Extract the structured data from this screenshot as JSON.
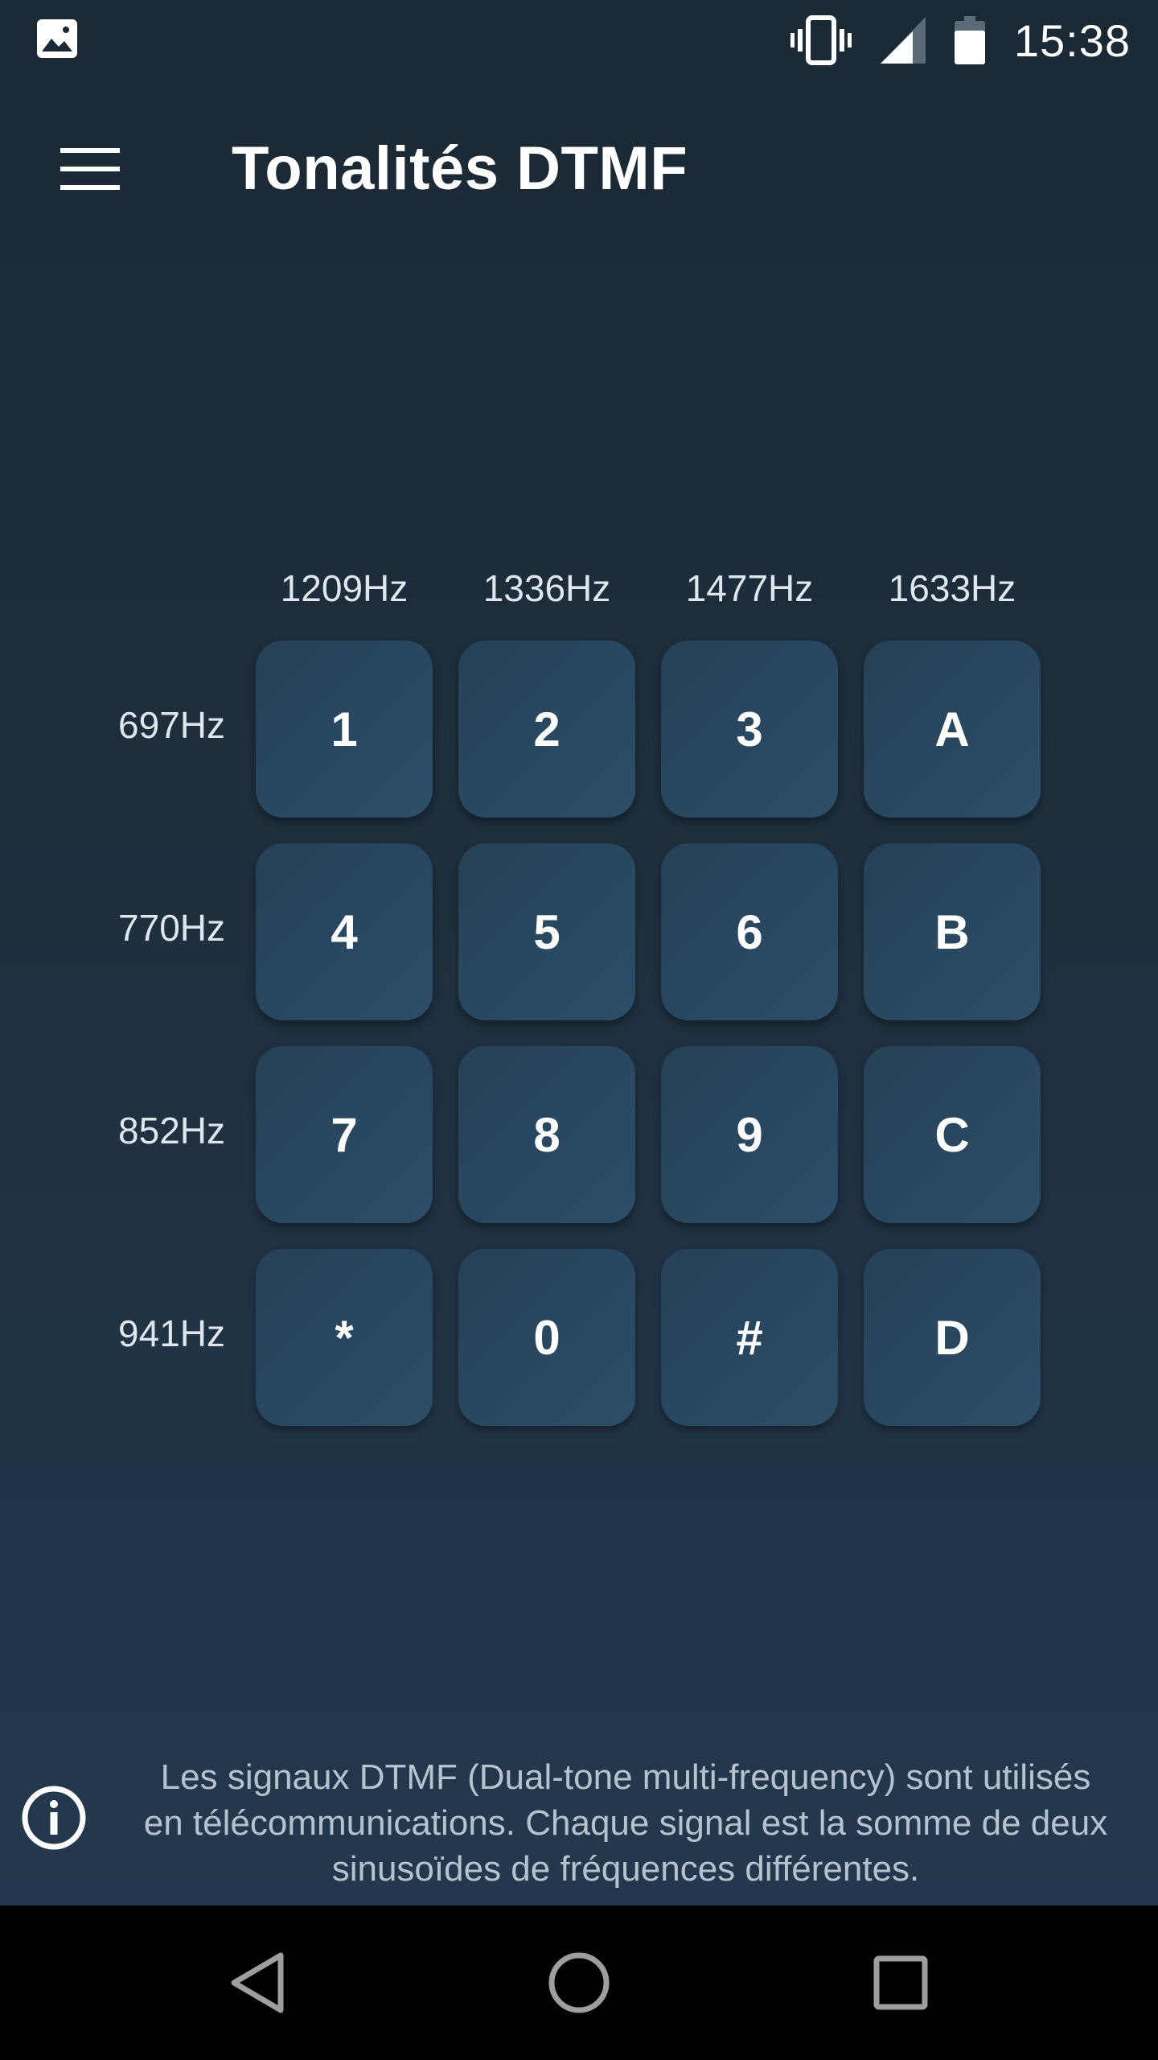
{
  "status_bar": {
    "time": "15:38",
    "icons": [
      "image-notification-icon",
      "vibrate-icon",
      "cell-signal-icon",
      "battery-icon"
    ]
  },
  "app_bar": {
    "title": "Tonalités DTMF",
    "menu_icon": "hamburger-menu-icon"
  },
  "keypad": {
    "column_frequencies": [
      "1209Hz",
      "1336Hz",
      "1477Hz",
      "1633Hz"
    ],
    "row_frequencies": [
      "697Hz",
      "770Hz",
      "852Hz",
      "941Hz"
    ],
    "keys": [
      [
        "1",
        "2",
        "3",
        "A"
      ],
      [
        "4",
        "5",
        "6",
        "B"
      ],
      [
        "7",
        "8",
        "9",
        "C"
      ],
      [
        "*",
        "0",
        "#",
        "D"
      ]
    ]
  },
  "info": {
    "icon": "info-icon",
    "line1": "Les signaux DTMF (Dual-tone multi-frequency) sont utilisés",
    "line2": "en télécommunications. Chaque signal est la somme de deux",
    "line3": "sinusoïdes de fréquences différentes."
  },
  "nav_bar": {
    "buttons": [
      "back-icon",
      "home-icon",
      "recents-icon"
    ]
  },
  "colors": {
    "background_top": "#1b2935",
    "background_bottom": "#243a50",
    "key": "#2a4762",
    "nav_bar": "#000000"
  }
}
